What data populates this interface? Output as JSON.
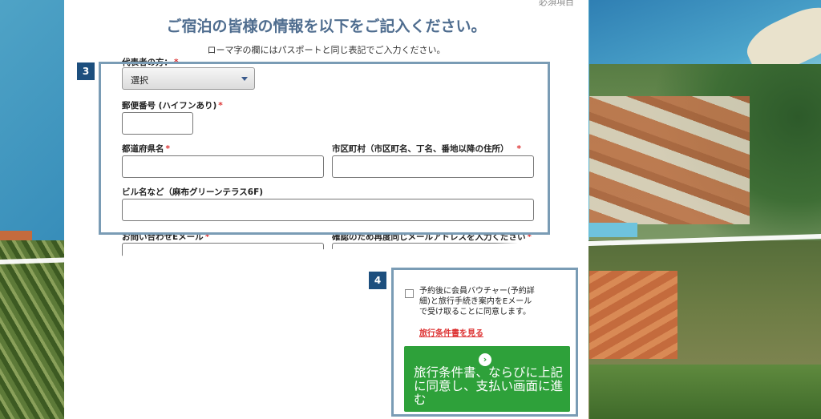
{
  "form": {
    "required_note": "必須項目",
    "title": "ご宿泊の皆様の情報を以下をご記入ください。",
    "romaji_note": "ローマ字の欄にはパスポートと同じ表記でご入力ください。",
    "representative": {
      "label": "代表者の方：",
      "required_mark": "*",
      "select_value": "選択"
    },
    "postal": {
      "label": "郵便番号 (ハイフンあり)",
      "required_mark": "*",
      "value": ""
    },
    "prefecture": {
      "label": "都道府県名",
      "required_mark": "*",
      "value": ""
    },
    "city": {
      "label": "市区町村（市区町名、丁名、番地以降の住所）",
      "required_mark": "*",
      "value": ""
    },
    "building": {
      "label": "ビル名など（麻布グリーンテラス6F)",
      "value": ""
    },
    "email": {
      "label": "お問い合わせEメール",
      "required_mark": "*"
    },
    "email_confirm": {
      "label": "確認のため再度同じメールアドレスを入力ください",
      "required_mark": "*"
    }
  },
  "steps": {
    "step3": "3",
    "step4": "4"
  },
  "agreement": {
    "checked": false,
    "text": "予約後に会員バウチャー(予約詳細)と旅行手続き案内をEメールで受け取ることに同意します。",
    "link": "旅行条件書を見る"
  },
  "submit": {
    "icon": "chevron-right-circle-icon",
    "label": "旅行条件書、ならびに上記に同意し、支払い画面に進む"
  },
  "colors": {
    "accent": "#1d4f7e",
    "highlight": "#7a9cb5",
    "button": "#2ea13a",
    "title": "#4f6d8f",
    "required": "#dd3333"
  }
}
